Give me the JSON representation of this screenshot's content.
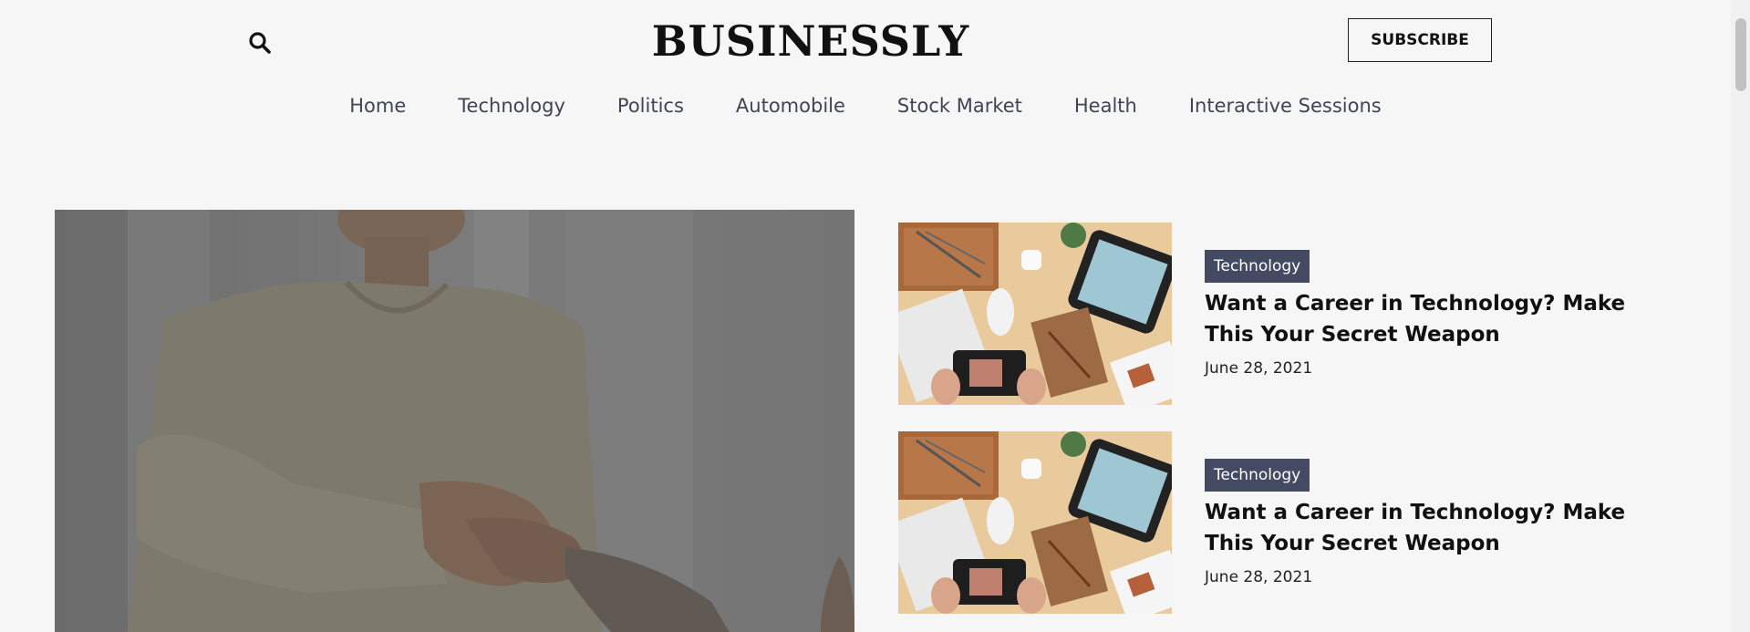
{
  "header": {
    "logo": "BUSINESSLY",
    "subscribe_label": "SUBSCRIBE"
  },
  "nav": {
    "items": [
      "Home",
      "Technology",
      "Politics",
      "Automobile",
      "Stock Market",
      "Health",
      "Interactive Sessions"
    ]
  },
  "articles": [
    {
      "category": "Technology",
      "title": "Want a Career in Technology? Make This Your Secret Weapon",
      "date": "June 28, 2021"
    },
    {
      "category": "Technology",
      "title": "Want a Career in Technology? Make This Your Secret Weapon",
      "date": "June 28, 2021"
    }
  ],
  "colors": {
    "background": "#f6f6f6",
    "tag_bg": "#454a63",
    "nav_text": "#3f4555"
  }
}
